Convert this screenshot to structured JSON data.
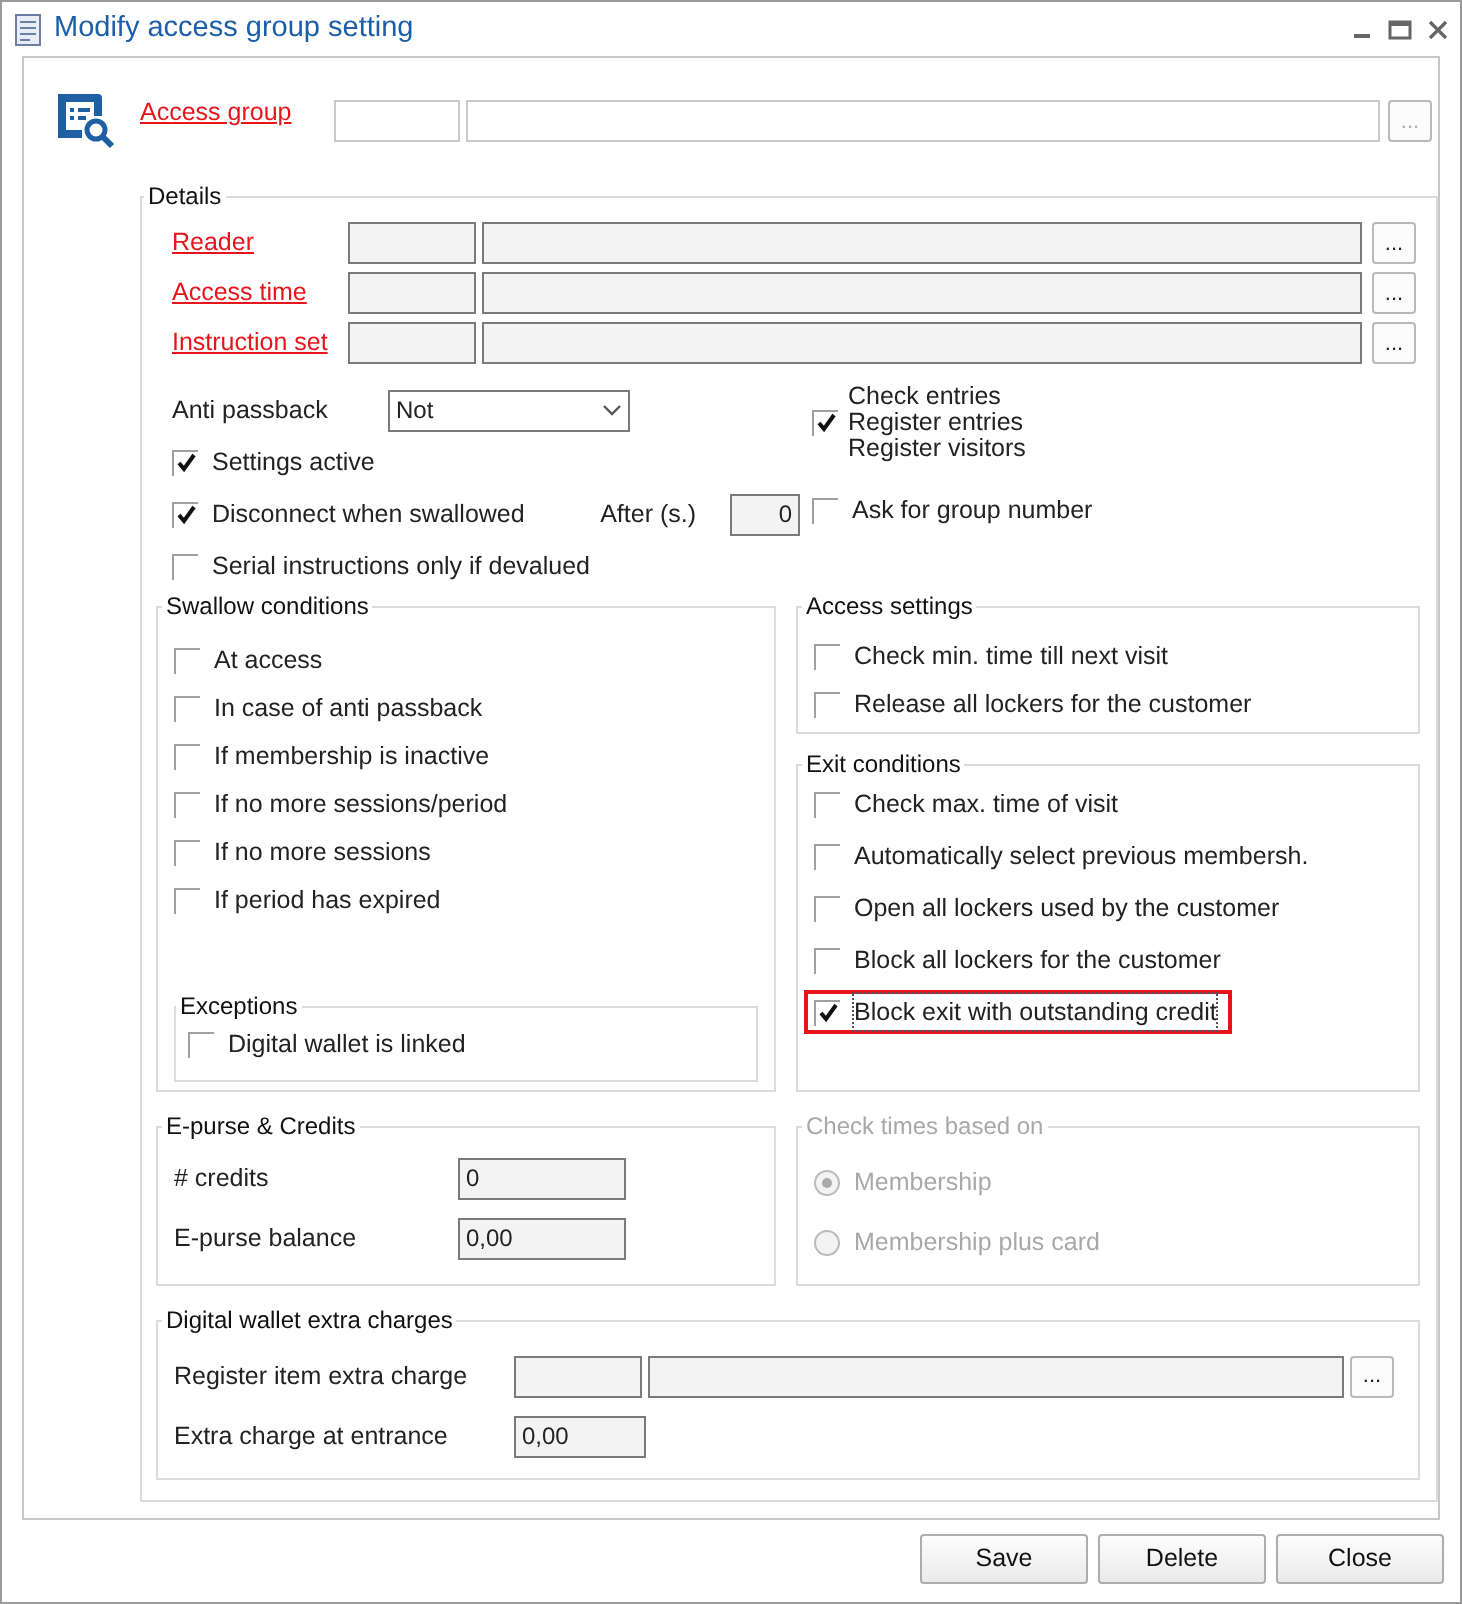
{
  "window": {
    "title": "Modify access group setting"
  },
  "access_group": {
    "label": "Access group",
    "button": "...",
    "disabled": true
  },
  "details": {
    "title": "Details",
    "lookups": [
      {
        "label": "Reader",
        "button": "..."
      },
      {
        "label": "Access time",
        "button": "..."
      },
      {
        "label": "Instruction set",
        "button": "..."
      }
    ],
    "anti_passback": {
      "label": "Anti passback",
      "value": "Not"
    },
    "options": [
      {
        "label": "Settings active",
        "checked": true
      },
      {
        "label": "Disconnect when swallowed",
        "checked": true
      },
      {
        "label": "Serial instructions only if devalued",
        "checked": false
      }
    ],
    "after": {
      "label": "After (s.)",
      "value": "0"
    },
    "entries": {
      "checked": true,
      "lines": [
        "Check entries",
        "Register entries",
        "Register visitors"
      ]
    },
    "ask_group": {
      "label": "Ask for group number",
      "checked": false
    }
  },
  "swallow_conditions": {
    "title": "Swallow conditions",
    "items": [
      {
        "label": "At access",
        "checked": false
      },
      {
        "label": "In case of anti passback",
        "checked": false
      },
      {
        "label": "If membership is inactive",
        "checked": false
      },
      {
        "label": "If no more sessions/period",
        "checked": false
      },
      {
        "label": "If no more sessions",
        "checked": false
      },
      {
        "label": "If period has expired",
        "checked": false
      }
    ],
    "exceptions": {
      "title": "Exceptions",
      "items": [
        {
          "label": "Digital wallet is linked",
          "checked": false
        }
      ]
    }
  },
  "access_settings": {
    "title": "Access settings",
    "items": [
      {
        "label": "Check min. time till next visit",
        "checked": false
      },
      {
        "label": "Release all lockers for the customer",
        "checked": false
      }
    ]
  },
  "exit_conditions": {
    "title": "Exit conditions",
    "items": [
      {
        "label": "Check max. time of visit",
        "checked": false,
        "highlighted": false
      },
      {
        "label": "Automatically select previous membersh.",
        "checked": false,
        "highlighted": false
      },
      {
        "label": "Open all lockers used by the customer",
        "checked": false,
        "highlighted": false
      },
      {
        "label": "Block all lockers for the customer",
        "checked": false,
        "highlighted": false
      },
      {
        "label": "Block exit with outstanding credit",
        "checked": true,
        "highlighted": true
      }
    ]
  },
  "epurse": {
    "title": "E-purse & Credits",
    "fields": [
      {
        "label": "# credits",
        "value": "0"
      },
      {
        "label": "E-purse balance",
        "value": "0,00"
      }
    ]
  },
  "check_times": {
    "title": "Check times based on",
    "disabled": true,
    "options": [
      {
        "label": "Membership",
        "selected": true
      },
      {
        "label": "Membership plus card",
        "selected": false
      }
    ]
  },
  "digital_wallet": {
    "title": "Digital wallet extra charges",
    "register_item": {
      "label": "Register item extra charge",
      "button": "..."
    },
    "entrance": {
      "label": "Extra charge at entrance",
      "value": "0,00"
    }
  },
  "buttons": [
    "Save",
    "Delete",
    "Close"
  ]
}
